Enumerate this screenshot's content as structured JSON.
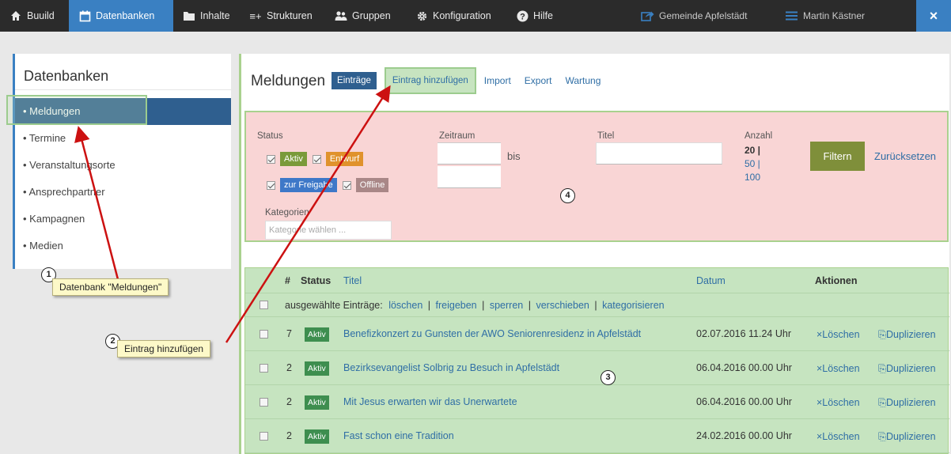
{
  "topnav": {
    "items": [
      {
        "label": "Buuild",
        "icon": "home-icon"
      },
      {
        "label": "Datenbanken",
        "icon": "calendar-icon"
      },
      {
        "label": "Inhalte",
        "icon": "folder-icon"
      },
      {
        "label": "Strukturen",
        "icon": "list-plus-icon"
      },
      {
        "label": "Gruppen",
        "icon": "users-icon"
      },
      {
        "label": "Konfiguration",
        "icon": "gear-icon"
      },
      {
        "label": "Hilfe",
        "icon": "help-icon"
      }
    ],
    "site": "Gemeinde Apfelstädt",
    "user": "Martin Kästner",
    "close": "×"
  },
  "sidebar": {
    "title": "Datenbanken",
    "items": [
      {
        "label": "• Meldungen"
      },
      {
        "label": "• Termine"
      },
      {
        "label": "• Veranstaltungsorte"
      },
      {
        "label": "• Ansprechpartner"
      },
      {
        "label": "• Kampagnen"
      },
      {
        "label": "• Medien"
      }
    ]
  },
  "main": {
    "title": "Meldungen",
    "tabs": {
      "entries": "Einträge",
      "add": "Eintrag hinzufügen",
      "import": "Import",
      "export": "Export",
      "maintenance": "Wartung"
    }
  },
  "filter": {
    "status_label": "Status",
    "status_badges": {
      "active": "Aktiv",
      "draft": "Entwurf",
      "release": "zur Freigabe",
      "offline": "Offline"
    },
    "period_label": "Zeitraum",
    "period_to": "bis",
    "title_label": "Titel",
    "count_label": "Anzahl",
    "count_options": {
      "a": "20 |",
      "b": "50 |",
      "c": "100"
    },
    "categories_label": "Kategorien",
    "categories_placeholder": "Kategorie wählen ...",
    "filter_button": "Filtern",
    "reset_link": "Zurücksetzen"
  },
  "list": {
    "headers": {
      "num": "#",
      "status": "Status",
      "title": "Titel",
      "date": "Datum",
      "actions": "Aktionen"
    },
    "bulk": {
      "label": "ausgewählte Einträge:",
      "delete": "löschen",
      "release": "freigeben",
      "lock": "sperren",
      "move": "verschieben",
      "categorize": "kategorisieren",
      "sep": "|"
    },
    "rows": [
      {
        "num": "7",
        "status": "Aktiv",
        "title": "Benefizkonzert zu Gunsten der AWO Seniorenresidenz in Apfelstädt",
        "date": "02.07.2016 11.24 Uhr",
        "delete": "×Löschen",
        "duplicate": "⎘Duplizieren"
      },
      {
        "num": "2",
        "status": "Aktiv",
        "title": "Bezirksevangelist Solbrig zu Besuch in Apfelstädt",
        "date": "06.04.2016 00.00 Uhr",
        "delete": "×Löschen",
        "duplicate": "⎘Duplizieren"
      },
      {
        "num": "2",
        "status": "Aktiv",
        "title": "Mit Jesus erwarten wir das Unerwartete",
        "date": "06.04.2016 00.00 Uhr",
        "delete": "×Löschen",
        "duplicate": "⎘Duplizieren"
      },
      {
        "num": "2",
        "status": "Aktiv",
        "title": "Fast schon eine Tradition",
        "date": "24.02.2016 00.00 Uhr",
        "delete": "×Löschen",
        "duplicate": "⎘Duplizieren"
      }
    ]
  },
  "annotations": {
    "c1": {
      "num": "1",
      "text": "Datenbank \"Meldungen\""
    },
    "c2": {
      "num": "2",
      "text": "Eintrag hinzufügen"
    },
    "c3": {
      "num": "3"
    },
    "c4": {
      "num": "4"
    }
  },
  "colors": {
    "nav_active": "#3a80c2",
    "filter_bg": "#f9d5d5",
    "list_bg": "#c6e4c0",
    "arrow": "#cc1111"
  }
}
